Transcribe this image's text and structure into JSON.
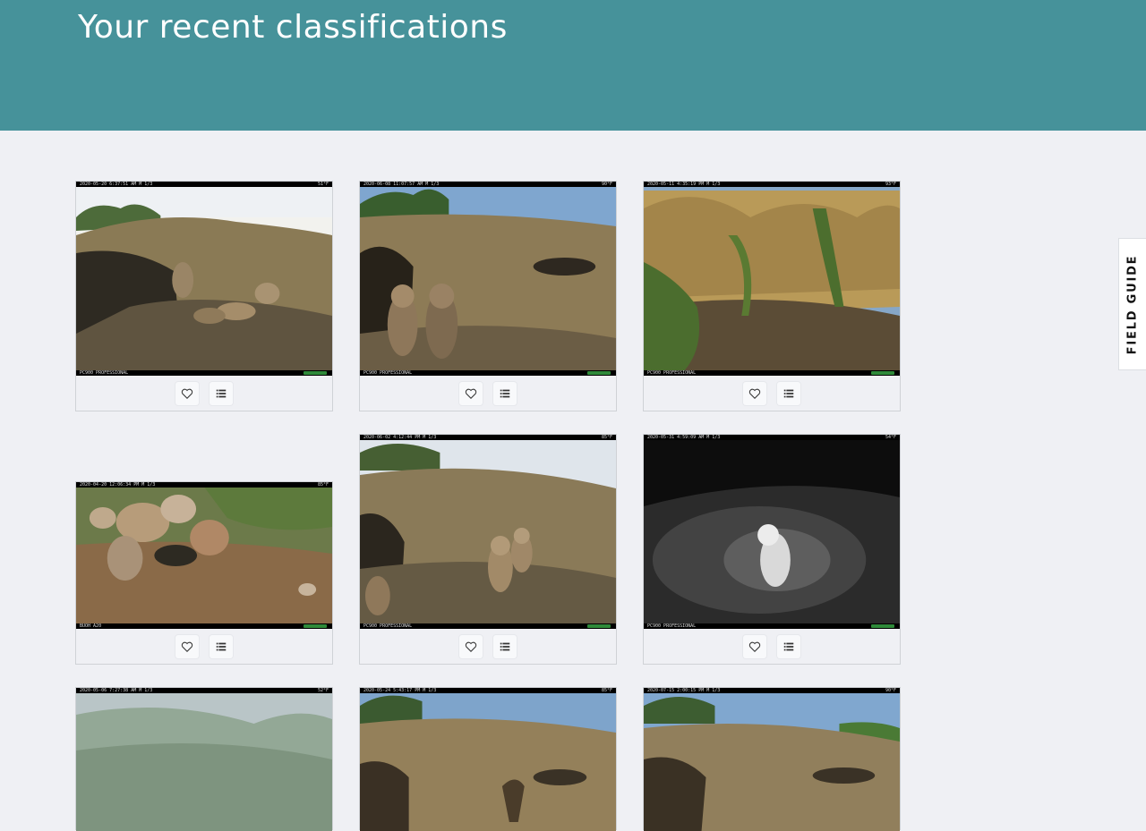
{
  "header": {
    "title": "Your recent classifications"
  },
  "field_guide": {
    "label": "FIELD GUIDE"
  },
  "colors": {
    "header_bg": "#46929a",
    "page_bg": "#eff0f4"
  },
  "cards": [
    {
      "stamp": "2020-05-20 6:37:51 AM  M 1/3",
      "temp": "51°F",
      "footer": "PC900 PROFESSIONAL",
      "scene": "day-owls-burrow"
    },
    {
      "stamp": "2020-06-08 11:07:57 AM  M 1/3",
      "temp": "90°F",
      "footer": "PC900 PROFESSIONAL",
      "scene": "day-two-owls"
    },
    {
      "stamp": "2020-05-11 4:35:19 PM  M 1/3",
      "temp": "93°F",
      "footer": "PC900 PROFESSIONAL",
      "scene": "day-grass"
    },
    {
      "stamp": "2020-04-20 12:06:34 PM  M 1/3",
      "temp": "85°F",
      "footer": "BUOH A20",
      "scene": "day-rocks"
    },
    {
      "stamp": "2020-06-02 4:12:44 PM  M 1/3",
      "temp": "85°F",
      "footer": "PC900 PROFESSIONAL",
      "scene": "day-owls-standing"
    },
    {
      "stamp": "2020-05-31 4:59:09 AM  M 1/3",
      "temp": "54°F",
      "footer": "PC900 PROFESSIONAL",
      "scene": "night-owl"
    },
    {
      "stamp": "2020-05-06 7:27:38 AM  M 1/3",
      "temp": "52°F",
      "footer": "",
      "scene": "foggy-grass"
    },
    {
      "stamp": "2020-05-24 5:43:17 PM  M 1/3",
      "temp": "85°F",
      "footer": "",
      "scene": "day-mound"
    },
    {
      "stamp": "2020-07-15 2:00:15 PM  M 1/3",
      "temp": "90°F",
      "footer": "",
      "scene": "day-mound-2"
    }
  ],
  "icons": {
    "favorite": "heart-outline-icon",
    "collect": "list-icon"
  }
}
